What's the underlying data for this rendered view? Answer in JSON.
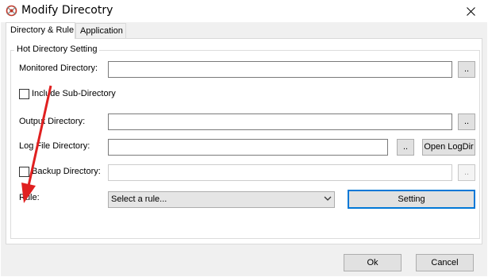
{
  "window": {
    "title": "Modify Direcotry"
  },
  "tabs": [
    {
      "label": "Directory & Rule",
      "active": true
    },
    {
      "label": "Application",
      "active": false
    }
  ],
  "group": {
    "title": "Hot Directory Setting"
  },
  "fields": {
    "monitored": {
      "label": "Monitored Directory:",
      "value": "",
      "browse": ".."
    },
    "include_sub": {
      "label": "Include Sub-Directory",
      "checked": false
    },
    "output": {
      "label": "Output Directory:",
      "value": "",
      "browse": ".."
    },
    "log": {
      "label": "Log File Directory:",
      "value": "",
      "browse": "..",
      "open_label": "Open LogDir"
    },
    "backup": {
      "label": "Backup Directory:",
      "checked": false,
      "value": "",
      "browse": ".."
    },
    "rule": {
      "label": "Rule:",
      "selected": "Select a rule...",
      "setting_label": "Setting"
    }
  },
  "footer": {
    "ok_label": "Ok",
    "cancel_label": "Cancel"
  },
  "colors": {
    "annotation_arrow": "#e02020",
    "focus": "#0078d7"
  }
}
